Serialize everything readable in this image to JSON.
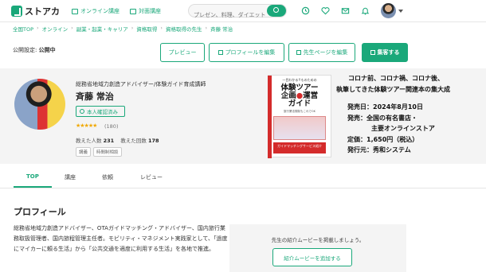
{
  "header": {
    "logo_text": "ストアカ",
    "nav": [
      {
        "label": "オンライン講座",
        "icon": "monitor-icon"
      },
      {
        "label": "対面講座",
        "icon": "board-icon"
      }
    ],
    "search_placeholder": "プレゼン、料理、ダイエット",
    "icons": [
      "history-icon",
      "heart-icon",
      "mail-icon",
      "bell-icon",
      "avatar"
    ]
  },
  "breadcrumb": [
    "全国TOP",
    "オンライン",
    "副業・起業・キャリア",
    "資格取得",
    "資格取得の先生",
    "斉藤 常治"
  ],
  "publish": {
    "label": "公開設定:",
    "status": "公開中"
  },
  "actions": {
    "preview": "プレビュー",
    "edit_profile": "プロフィールを編集",
    "edit_page": "先生ページを編集",
    "attract": "集客する"
  },
  "profile": {
    "role": "総務省地域力創造アドバイザー/体験ガイド育成講師",
    "name": "斉藤 常治",
    "verified": "本人確認済み",
    "stars": "★★★★★",
    "rating_count": "(180)",
    "students_label": "教えた人数",
    "students": "231",
    "lessons_label": "教えた回数",
    "lessons": "178",
    "tags": [
      "講義",
      "時間制相談"
    ]
  },
  "book": {
    "top": "一目わかる!!ものための",
    "title_1": "体験ツアー",
    "title_2a": "企画",
    "title_2b": "●",
    "title_2c": "運営",
    "title_3": "ガイド",
    "sub": "旅行業法規制もこれでOK",
    "band": "ガイドマッチングサービス紹介"
  },
  "promo": {
    "line1": "コロナ前、コロナ禍、コロナ後、",
    "line2": "執筆してきた体験ツアー関連本の集大成",
    "release": "発売日：2024年8月10日",
    "sale1": "発売：全国の有名書店・",
    "sale2": "主要オンラインストア",
    "price": "定価：1,650円（税込）",
    "publisher": "発行元：秀和システム"
  },
  "tabs": [
    "TOP",
    "講座",
    "依頼",
    "レビュー"
  ],
  "section": {
    "title": "プロフィール",
    "bio": "総務省地域力創造アドバイザー、OTAガイドマッチング・アドバイザー、国内旅行業務取扱管理者、国内旅程管理主任者。モビリティ・マネジメント実践家として、「過度にマイカーに頼る生活」から「公共交通を適度に利用する生活」を各地で推進。"
  },
  "movie": {
    "text": "先生の紹介ムービーを掲載しましょう。",
    "button": "紹介ムービーを追加する"
  },
  "colors": {
    "accent": "#1aa87a",
    "book_red": "#d42b2b",
    "star": "#f0a800"
  }
}
